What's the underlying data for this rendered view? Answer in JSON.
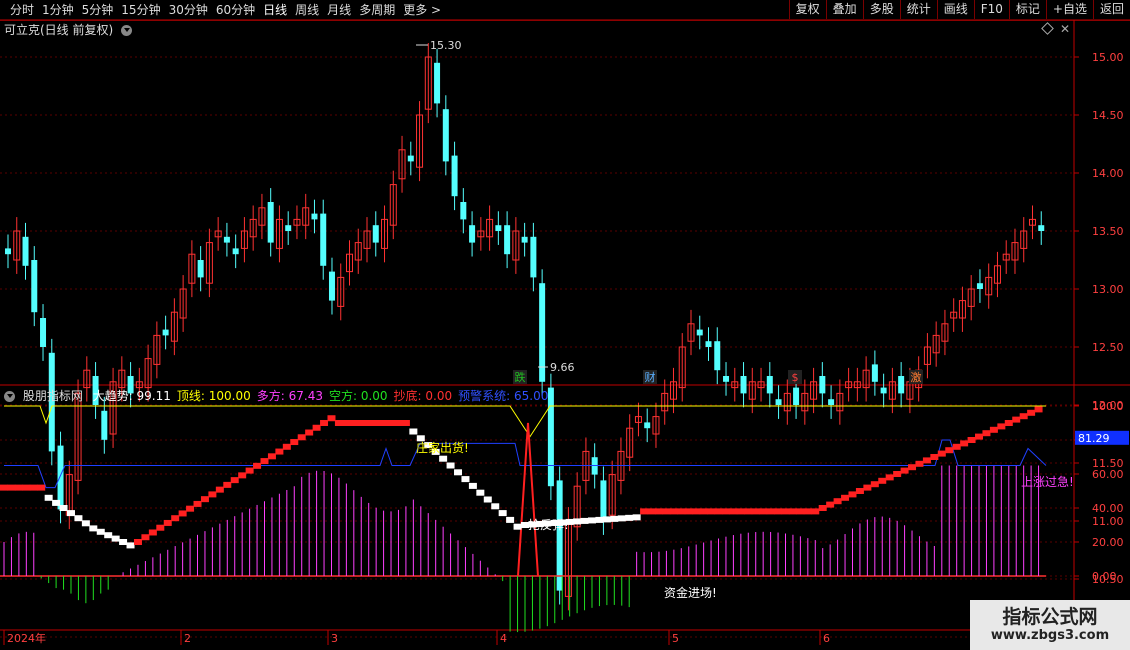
{
  "toolbar": {
    "left": [
      "分时",
      "1分钟",
      "5分钟",
      "15分钟",
      "30分钟",
      "60分钟",
      "日线",
      "周线",
      "月线",
      "多周期",
      "更多 >"
    ],
    "active_index": 6,
    "right": [
      "复权",
      "叠加",
      "多股",
      "统计",
      "画线",
      "F10",
      "标记",
      "+自选",
      "返回"
    ]
  },
  "stock_title": "可立克(日线 前复权)",
  "price_axis": [
    "15.00",
    "14.50",
    "14.00",
    "13.50",
    "13.00",
    "12.50",
    "12.00",
    "11.50",
    "11.00",
    "10.50",
    "10.00"
  ],
  "high_label": "15.30",
  "low_label": "9.66",
  "event_markers": [
    {
      "label": "跌",
      "color": "#20c020"
    },
    {
      "label": "财",
      "color": "#5ab0ff"
    },
    {
      "label": "$",
      "color": "#ff4040"
    },
    {
      "label": "激",
      "color": "#ff7a30"
    }
  ],
  "indicator": {
    "name": "股朋指标网",
    "fields": [
      {
        "text": "大趋势: 99.11",
        "color": "#ffffff"
      },
      {
        "text": "顶线: 100.00",
        "color": "#ffff00"
      },
      {
        "text": "多方: 67.43",
        "color": "#ff40ff"
      },
      {
        "text": "空方: 0.00",
        "color": "#20e020"
      },
      {
        "text": "抄底: 0.00",
        "color": "#ff3030"
      },
      {
        "text": "预警系统: 65.00",
        "color": "#3050ff"
      }
    ],
    "axis": [
      "100.0",
      "80.00",
      "60.00",
      "40.00",
      "20.00",
      "0.00"
    ],
    "current_value": "81.29",
    "annotations": {
      "distribute": "庄家出货!",
      "rebound": "抢反弹!",
      "inflow": "资金进场!",
      "overheat": "上涨过急!"
    }
  },
  "date_axis": [
    "2024年",
    "2",
    "3",
    "4",
    "5",
    "6"
  ],
  "watermark": {
    "line1": "指标公式网",
    "line2": "www.zbgs3.com"
  },
  "colors": {
    "up": "#ff3232",
    "down": "#54ffff",
    "grid": "#5a0000",
    "axis": "#c00000"
  }
}
